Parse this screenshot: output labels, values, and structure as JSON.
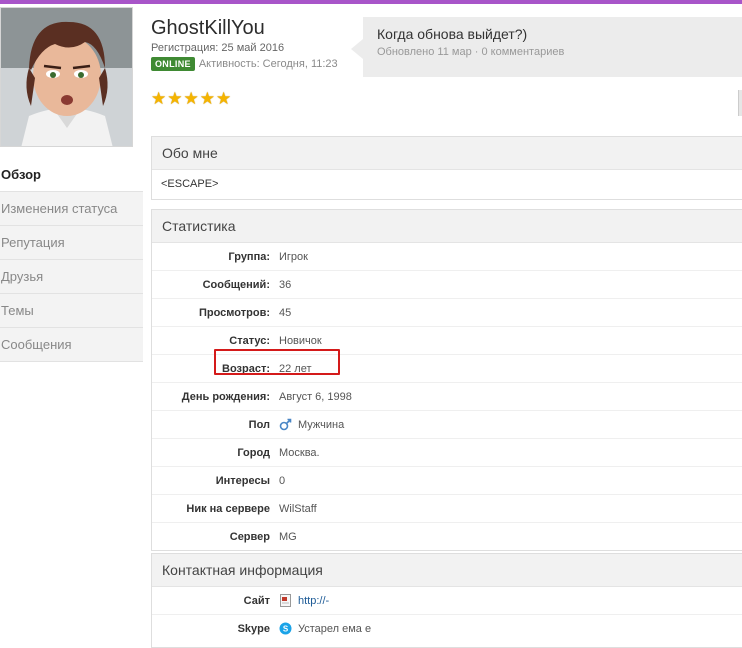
{
  "profile": {
    "username": "GhostKillYou",
    "registration": "Регистрация: 25 май 2016",
    "online_badge": "ONLINE",
    "activity": "Активность: Сегодня, 11:23",
    "stars": 5
  },
  "status_update": {
    "text": "Когда обнова выйдет?)",
    "updated": "Обновлено 11 мар",
    "separator": "·",
    "comments": "0 комментариев"
  },
  "sidebar": {
    "items": [
      {
        "label": "Обзор",
        "active": true
      },
      {
        "label": "Изменения статуса",
        "active": false
      },
      {
        "label": "Репутация",
        "active": false
      },
      {
        "label": "Друзья",
        "active": false
      },
      {
        "label": "Темы",
        "active": false
      },
      {
        "label": "Сообщения",
        "active": false
      }
    ]
  },
  "about": {
    "title": "Обо мне",
    "content": "<ESCAPE>"
  },
  "stats": {
    "title": "Статистика",
    "rows": [
      {
        "label": "Группа:",
        "value": "Игрок"
      },
      {
        "label": "Сообщений:",
        "value": "36"
      },
      {
        "label": "Просмотров:",
        "value": "45"
      },
      {
        "label": "Статус:",
        "value": "Новичок"
      },
      {
        "label": "Возраст:",
        "value": "22 лет"
      },
      {
        "label": "День рождения:",
        "value": "Август 6, 1998"
      },
      {
        "label": "Пол",
        "value": "Мужчина",
        "icon": "male-gender-icon"
      },
      {
        "label": "Город",
        "value": "Москва."
      },
      {
        "label": "Интересы",
        "value": "0"
      },
      {
        "label": "Ник на сервере",
        "value": "WilStaff"
      },
      {
        "label": "Сервер",
        "value": "MG"
      }
    ]
  },
  "contact": {
    "title": "Контактная информация",
    "rows": [
      {
        "label": "Сайт",
        "value": "http://-",
        "icon": "website-icon"
      },
      {
        "label": "Skype",
        "value": "Устарел ема е",
        "icon": "skype-icon"
      }
    ]
  },
  "colors": {
    "online": "#3f8a33",
    "highlight": "#d41a1a",
    "star": "#f5b400",
    "accent_line": "#a855c9"
  }
}
